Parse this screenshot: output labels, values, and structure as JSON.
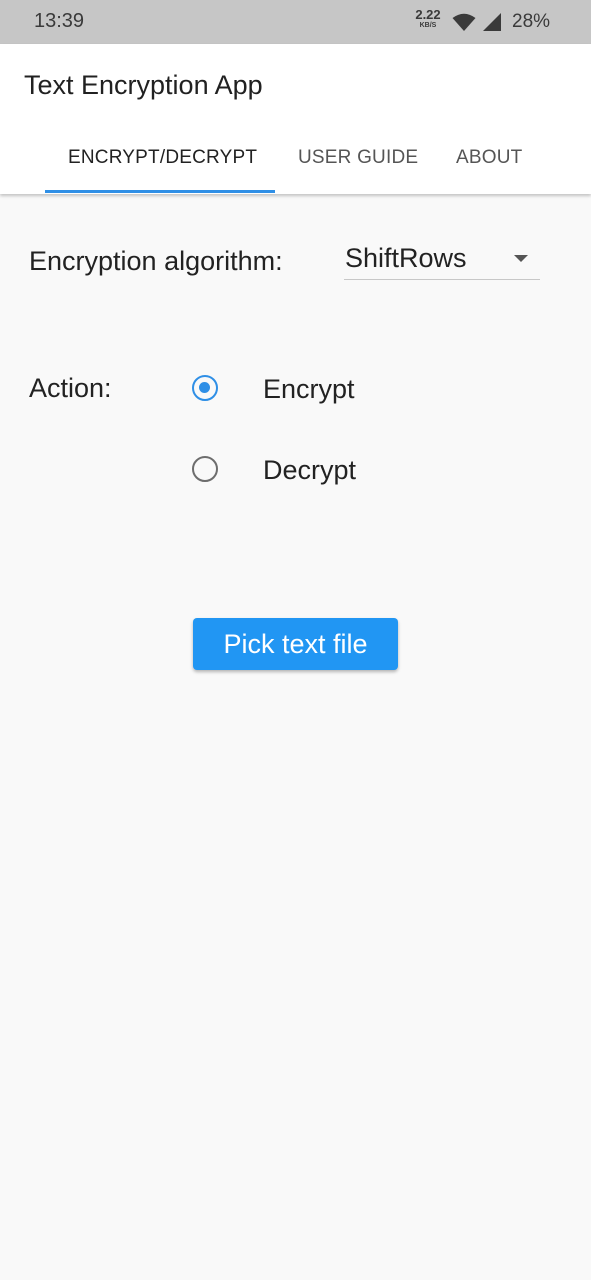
{
  "status_bar": {
    "time": "13:39",
    "net_speed_value": "2.22",
    "net_speed_unit": "KB/S",
    "battery": "28%",
    "icons": [
      "wifi-icon",
      "cell-signal-icon"
    ]
  },
  "app_bar": {
    "title": "Text Encryption App",
    "tabs": [
      {
        "label": "ENCRYPT/DECRYPT",
        "active": true
      },
      {
        "label": "USER GUIDE",
        "active": false
      },
      {
        "label": "ABOUT",
        "active": false
      }
    ]
  },
  "form": {
    "algorithm_label": "Encryption algorithm:",
    "algorithm_selected": "ShiftRows",
    "action_label": "Action:",
    "options": [
      {
        "label": "Encrypt",
        "checked": true
      },
      {
        "label": "Decrypt",
        "checked": false
      }
    ],
    "pick_button_label": "Pick text file"
  },
  "colors": {
    "accent": "#2f8fe6",
    "button": "#2196f3",
    "status_bar": "#c6c6c6",
    "background": "#f9f9f9"
  }
}
